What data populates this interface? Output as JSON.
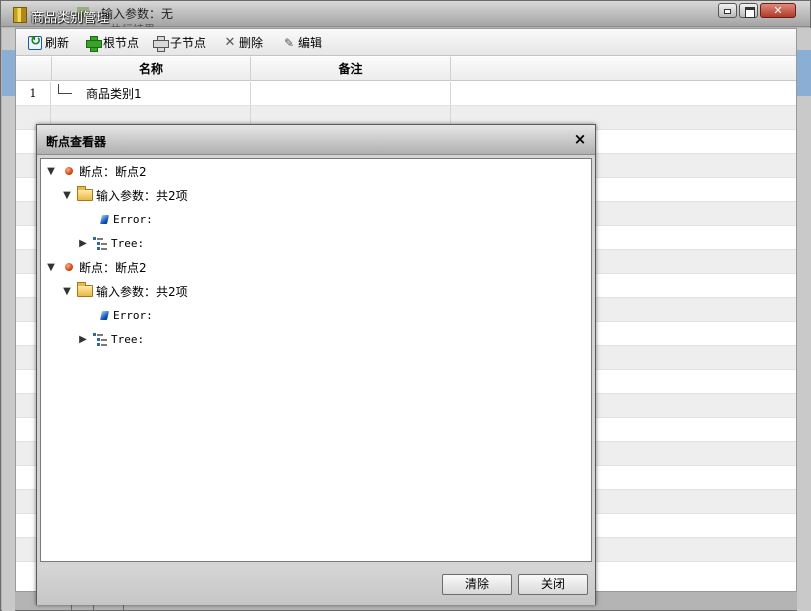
{
  "window": {
    "title": "商品类别管理",
    "ghost_text": "输入参数：无",
    "ghost_text_2": "执行结果"
  },
  "toolbar": {
    "refresh": "刷新",
    "add_root": "根节点",
    "add_child": "子节点",
    "delete": "删除",
    "edit": "编辑"
  },
  "grid": {
    "columns": [
      "名称",
      "备注"
    ],
    "rows": [
      {
        "num": "1",
        "name": "商品类别1",
        "note": ""
      }
    ]
  },
  "dialog": {
    "title": "断点查看器",
    "close_glyph": "×",
    "tree": [
      {
        "label": "断点：断点2",
        "children": [
          {
            "label": "输入参数：共2项",
            "children": [
              "Error:",
              "Tree:"
            ]
          }
        ]
      },
      {
        "label": "断点：断点2",
        "children": [
          {
            "label": "输入参数：共2项",
            "children": [
              "Error:",
              "Tree:"
            ]
          }
        ]
      }
    ],
    "buttons": {
      "clear": "清除",
      "close": "关闭"
    }
  },
  "icons": {
    "breakpoint": "breakpoint-dot-icon",
    "folder": "folder-open-icon",
    "error": "blue-gem-icon",
    "tree": "tree-structure-icon"
  },
  "colors": {
    "breakpoint_dot": "#d04818",
    "toolbar_add": "#3aa12a",
    "alt_row": "#eeeeee"
  }
}
